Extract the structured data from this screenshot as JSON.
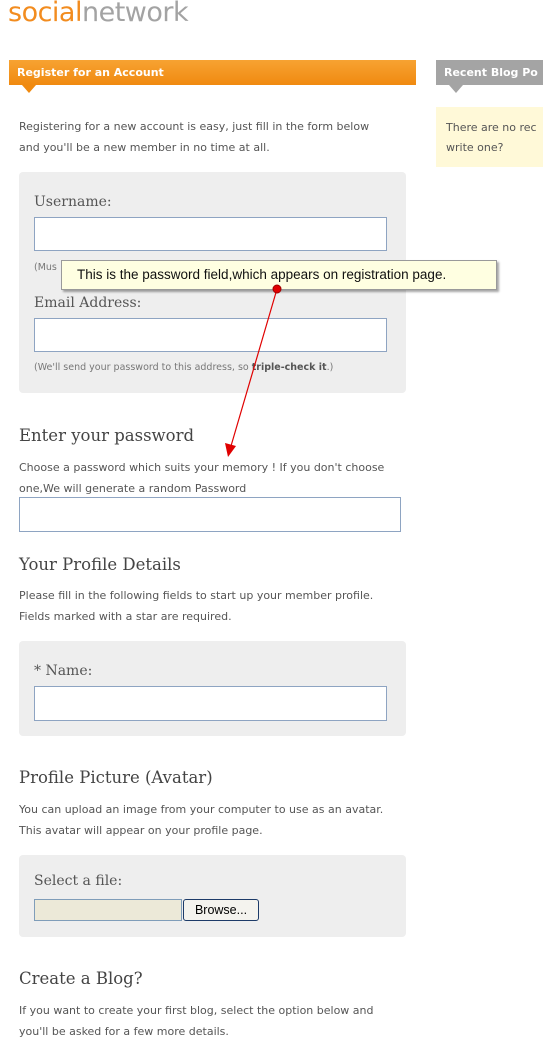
{
  "logo": {
    "part1": "social",
    "part2": "network"
  },
  "tabs": {
    "register": "Register for an Account",
    "recent_blog": "Recent Blog Po"
  },
  "sidebar": {
    "line1": "There are no rec",
    "line2": "write one?"
  },
  "intro": {
    "line1": "Registering for a new account is easy, just fill in the form below",
    "line2": "and you'll be a new member in no time at all."
  },
  "account": {
    "username_label": "Username:",
    "username_hint": "(Mus",
    "email_label": "Email Address:",
    "email_hint": "(We'll send your password to this address, so ",
    "email_hint_bold": "triple-check it",
    "email_hint_end": ".)"
  },
  "password": {
    "heading": "Enter your password",
    "desc_line1": "Choose a password which suits your memory ! If you don't choose",
    "desc_line2": "one,We will generate a random Password"
  },
  "profile": {
    "heading": "Your Profile Details",
    "desc_line1": "Please fill in the following fields to start up your member profile.",
    "desc_line2": "Fields marked with a star are required.",
    "name_label": "* Name:"
  },
  "avatar": {
    "heading": "Profile Picture (Avatar)",
    "desc_line1": "You can upload an image from your computer to use as an avatar.",
    "desc_line2": "This avatar will appear on your profile page.",
    "select_label": "Select a file:",
    "browse_label": "Browse..."
  },
  "blog": {
    "heading": "Create a Blog?",
    "desc_line1": "If you want to create your first blog, select the option below and",
    "desc_line2": "you'll be asked for a few more details."
  },
  "annotation": {
    "text": "This is the password field,which appears on registration page."
  },
  "colors": {
    "accent": "#f08a10",
    "logo_gray": "#a3a3a3",
    "panel": "#eeeeee",
    "callout_bg": "#ffffe1",
    "arrow": "#e00000"
  }
}
